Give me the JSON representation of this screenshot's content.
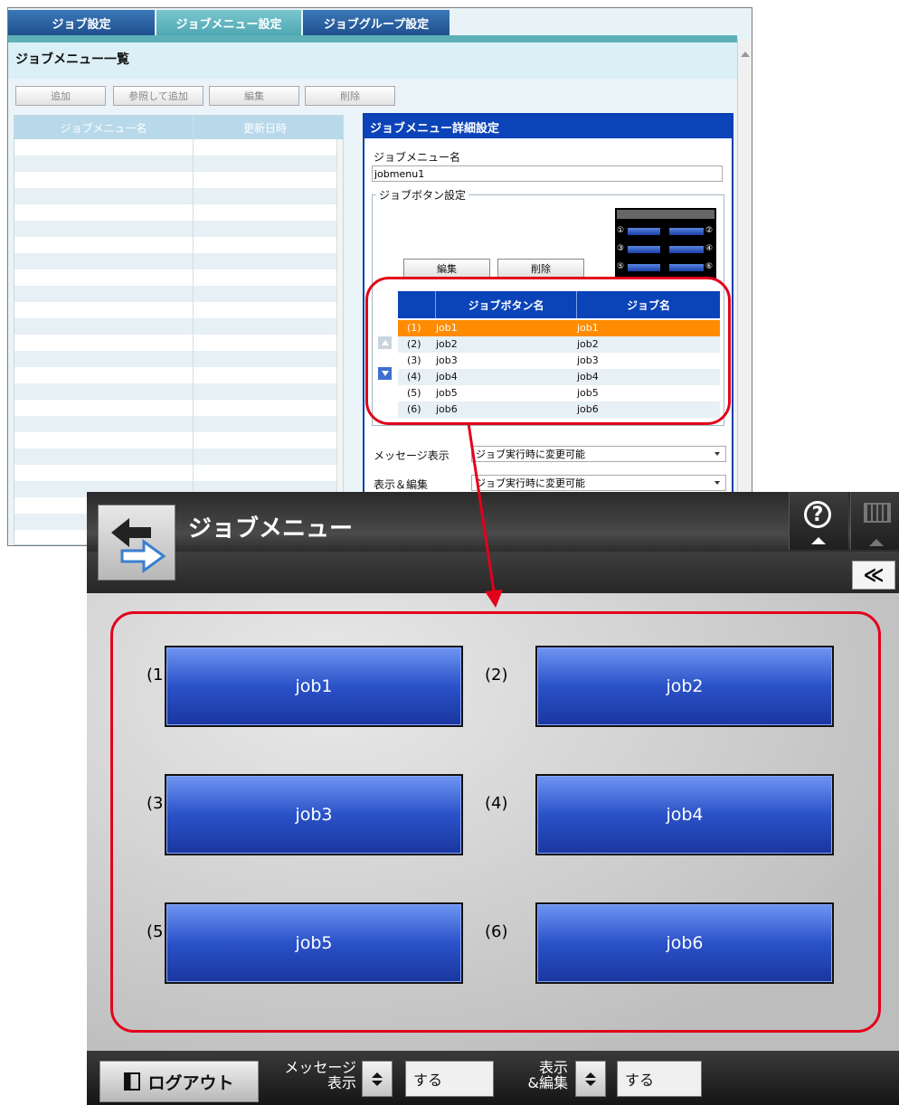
{
  "admin": {
    "tabs": [
      {
        "label": "ジョブ設定",
        "active": false
      },
      {
        "label": "ジョブメニュー設定",
        "active": true
      },
      {
        "label": "ジョブグループ設定",
        "active": false
      }
    ],
    "list_title": "ジョブメニュー一覧",
    "toolbar": {
      "add": "追加",
      "add_ref": "参照して追加",
      "edit": "編集",
      "delete": "削除"
    },
    "list_columns": {
      "name": "ジョブメニュー名",
      "updated": "更新日時"
    },
    "detail": {
      "title": "ジョブメニュー詳細設定",
      "name_label": "ジョブメニュー名",
      "name_value": "jobmenu1",
      "button_group_legend": "ジョブボタン設定",
      "preview_numbers": [
        "①",
        "②",
        "③",
        "④",
        "⑤",
        "⑥"
      ],
      "edit_button": "編集",
      "delete_button": "削除",
      "table_headers": {
        "button_name": "ジョブボタン名",
        "job_name": "ジョブ名"
      },
      "rows": [
        {
          "index": "(1)",
          "button_name": "job1",
          "job_name": "job1",
          "selected": true
        },
        {
          "index": "(2)",
          "button_name": "job2",
          "job_name": "job2",
          "selected": false
        },
        {
          "index": "(3)",
          "button_name": "job3",
          "job_name": "job3",
          "selected": false
        },
        {
          "index": "(4)",
          "button_name": "job4",
          "job_name": "job4",
          "selected": false
        },
        {
          "index": "(5)",
          "button_name": "job5",
          "job_name": "job5",
          "selected": false
        },
        {
          "index": "(6)",
          "button_name": "job6",
          "job_name": "job6",
          "selected": false
        }
      ],
      "message_label": "メッセージ表示",
      "message_value": "ジョブ実行時に変更可能",
      "display_edit_label": "表示＆編集",
      "display_edit_value": "ジョブ実行時に変更可能"
    }
  },
  "panel": {
    "title": "ジョブメニュー",
    "help_glyph": "?",
    "collapse_glyph": "≪",
    "jobs": [
      {
        "index": "(1)",
        "label": "job1"
      },
      {
        "index": "(2)",
        "label": "job2"
      },
      {
        "index": "(3)",
        "label": "job3"
      },
      {
        "index": "(4)",
        "label": "job4"
      },
      {
        "index": "(5)",
        "label": "job5"
      },
      {
        "index": "(6)",
        "label": "job6"
      }
    ],
    "footer": {
      "logout": "ログアウト",
      "message_label_1": "メッセージ",
      "message_label_2": "表示",
      "message_value": "する",
      "display_label_1": "表示",
      "display_label_2": "&編集",
      "display_value": "する"
    }
  },
  "colors": {
    "accent_blue": "#0b43b8",
    "tab_blue": "#1e4f8e",
    "tab_active": "#4ea7b2",
    "selected_row": "#ff8c00",
    "callout_red": "#e3001b"
  }
}
